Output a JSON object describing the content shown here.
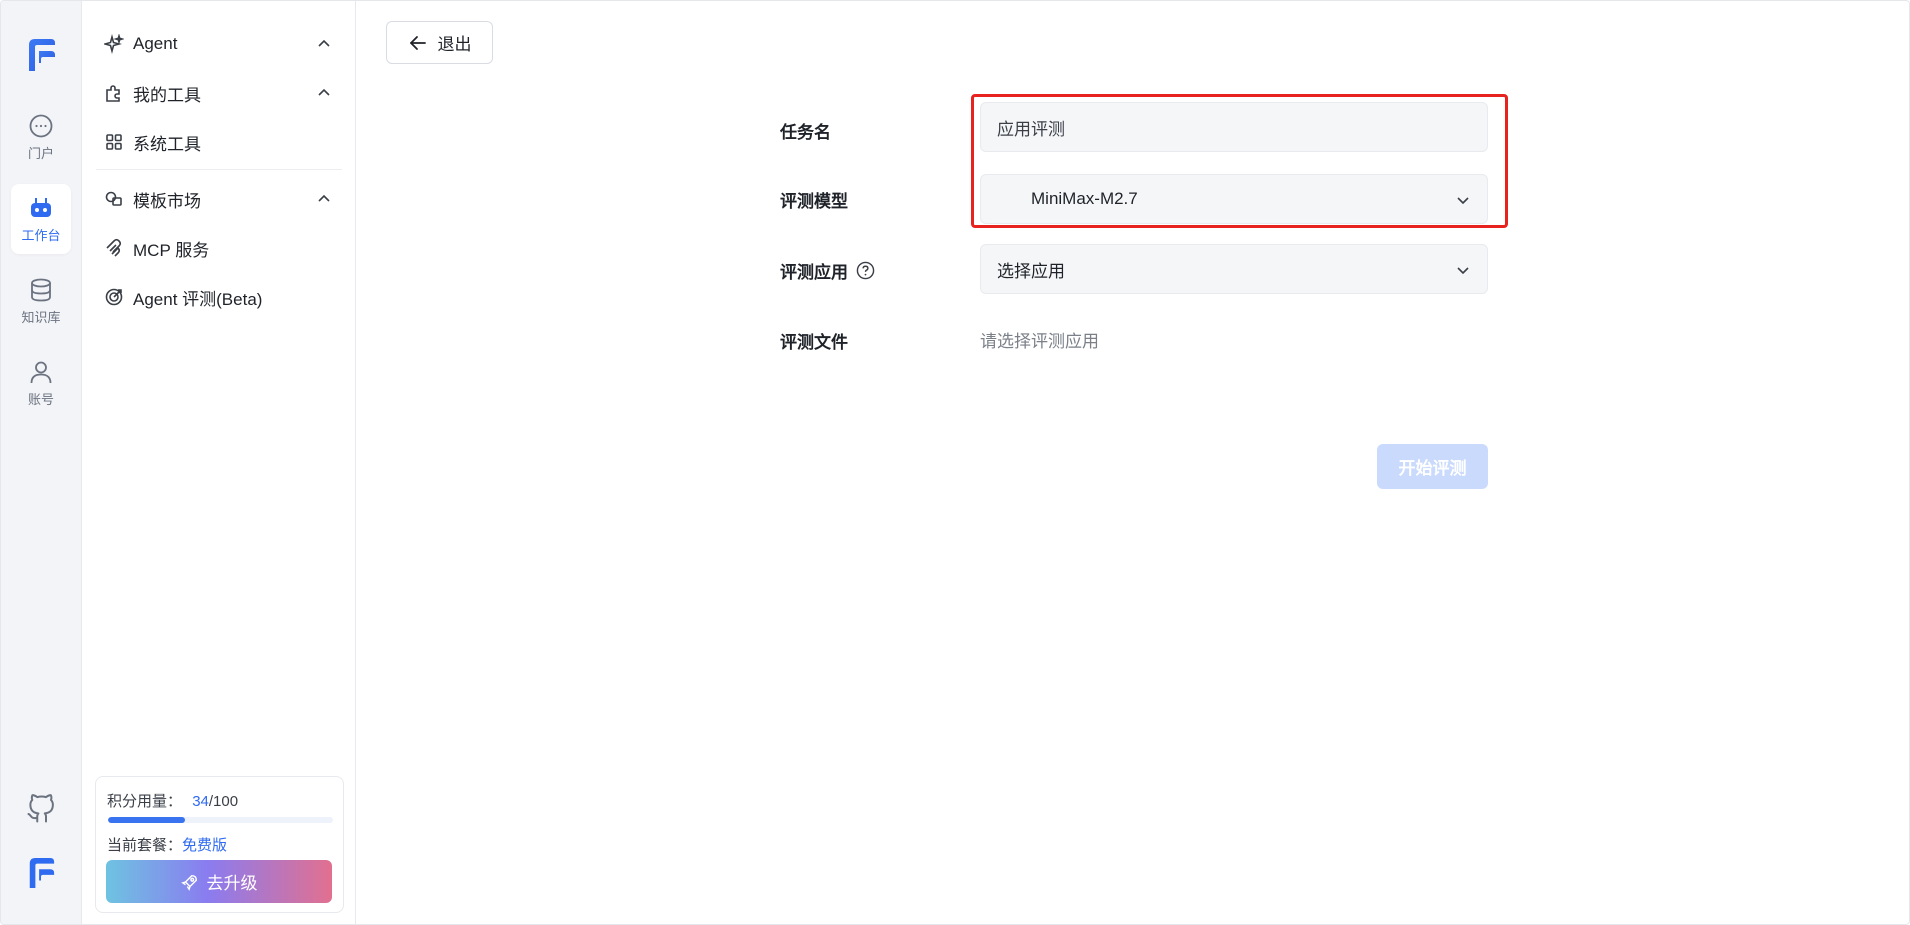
{
  "rail": {
    "items": [
      {
        "label": "门户",
        "icon": "chat-bubble-icon"
      },
      {
        "label": "工作台",
        "icon": "robot-icon",
        "active": true
      },
      {
        "label": "知识库",
        "icon": "database-icon"
      },
      {
        "label": "账号",
        "icon": "user-icon"
      }
    ],
    "bottom_icons": [
      "github-icon",
      "logo-icon"
    ]
  },
  "sidebar": {
    "items": [
      {
        "label": "Agent",
        "icon": "sparkle-icon",
        "expandable": true
      },
      {
        "label": "我的工具",
        "icon": "puzzle-icon",
        "expandable": true
      },
      {
        "label": "系统工具",
        "icon": "grid-icon"
      },
      {
        "label": "模板市场",
        "icon": "shapes-icon",
        "expandable": true
      },
      {
        "label": "MCP 服务",
        "icon": "mcp-icon"
      },
      {
        "label": "Agent 评测(Beta)",
        "icon": "target-icon"
      }
    ],
    "usage": {
      "label": "积分用量：",
      "used": "34",
      "total": "/100",
      "progress": 0.34,
      "plan_label": "当前套餐：",
      "plan_value": "免费版",
      "upgrade_label": "去升级"
    }
  },
  "main": {
    "exit_label": "退出",
    "form": {
      "task_name_label": "任务名",
      "task_name_value": "应用评测",
      "model_label": "评测模型",
      "model_value": "MiniMax-M2.7",
      "app_label": "评测应用",
      "app_placeholder": "选择应用",
      "file_label": "评测文件",
      "file_hint": "请选择评测应用"
    },
    "start_label": "开始评测"
  },
  "colors": {
    "accent": "#2f6bf0",
    "highlight": "#e8231f",
    "disabled_button": "#c9dafc"
  }
}
